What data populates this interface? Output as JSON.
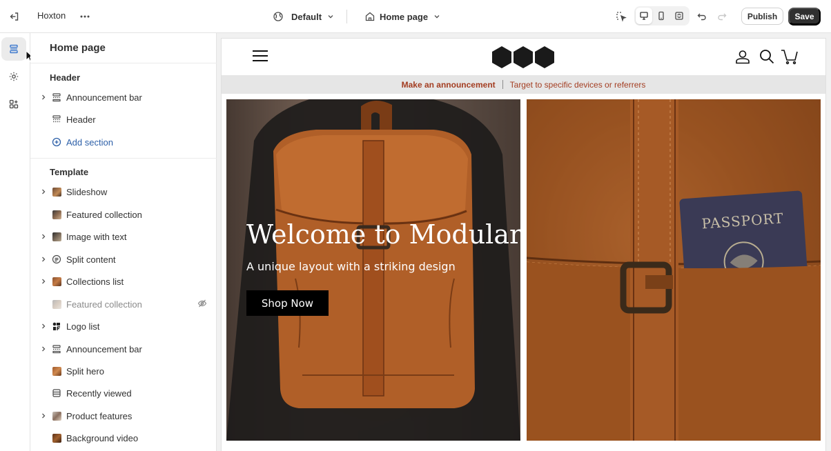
{
  "topbar": {
    "store_name": "Hoxton",
    "theme_label": "Default",
    "page_label": "Home page",
    "publish_label": "Publish",
    "save_label": "Save"
  },
  "rail": {
    "items": [
      {
        "name": "sections",
        "icon": "sections-icon",
        "active": true
      },
      {
        "name": "theme-settings",
        "icon": "gear-icon",
        "active": false
      },
      {
        "name": "app-embeds",
        "icon": "apps-icon",
        "active": false
      }
    ]
  },
  "sidebar": {
    "title": "Home page",
    "header_heading": "Header",
    "header_items": [
      {
        "label": "Announcement bar",
        "icon": "announcement-icon",
        "expandable": true
      },
      {
        "label": "Header",
        "icon": "header-icon",
        "expandable": false
      }
    ],
    "add_section_label": "Add section",
    "template_heading": "Template",
    "template_items": [
      {
        "label": "Slideshow",
        "icon": "image-thumb",
        "expandable": true,
        "hidden": false
      },
      {
        "label": "Featured collection",
        "icon": "image-thumb",
        "expandable": false,
        "hidden": false
      },
      {
        "label": "Image with text",
        "icon": "image-thumb",
        "expandable": true,
        "hidden": false
      },
      {
        "label": "Split content",
        "icon": "text-icon",
        "expandable": true,
        "hidden": false
      },
      {
        "label": "Collections list",
        "icon": "image-thumb",
        "expandable": true,
        "hidden": false
      },
      {
        "label": "Featured collection",
        "icon": "image-thumb",
        "expandable": false,
        "hidden": true
      },
      {
        "label": "Logo list",
        "icon": "logo-thumb",
        "expandable": true,
        "hidden": false
      },
      {
        "label": "Announcement bar",
        "icon": "announcement-icon",
        "expandable": true,
        "hidden": false
      },
      {
        "label": "Split hero",
        "icon": "image-thumb",
        "expandable": false,
        "hidden": false
      },
      {
        "label": "Recently viewed",
        "icon": "recent-icon",
        "expandable": false,
        "hidden": false
      },
      {
        "label": "Product features",
        "icon": "image-thumb",
        "expandable": true,
        "hidden": false
      },
      {
        "label": "Background video",
        "icon": "image-thumb",
        "expandable": false,
        "hidden": false
      }
    ]
  },
  "preview": {
    "announcement_main": "Make an announcement",
    "announcement_sub": "Target to specific devices or referrers",
    "hero_title": "Welcome to Modular",
    "hero_subtitle": "A unique layout with a striking design",
    "hero_button": "Shop Now",
    "passport_text": "PASSPORT"
  },
  "colors": {
    "accent_link": "#2c5fa8",
    "announcement_text": "#a33d21",
    "save_bg": "#303030"
  }
}
